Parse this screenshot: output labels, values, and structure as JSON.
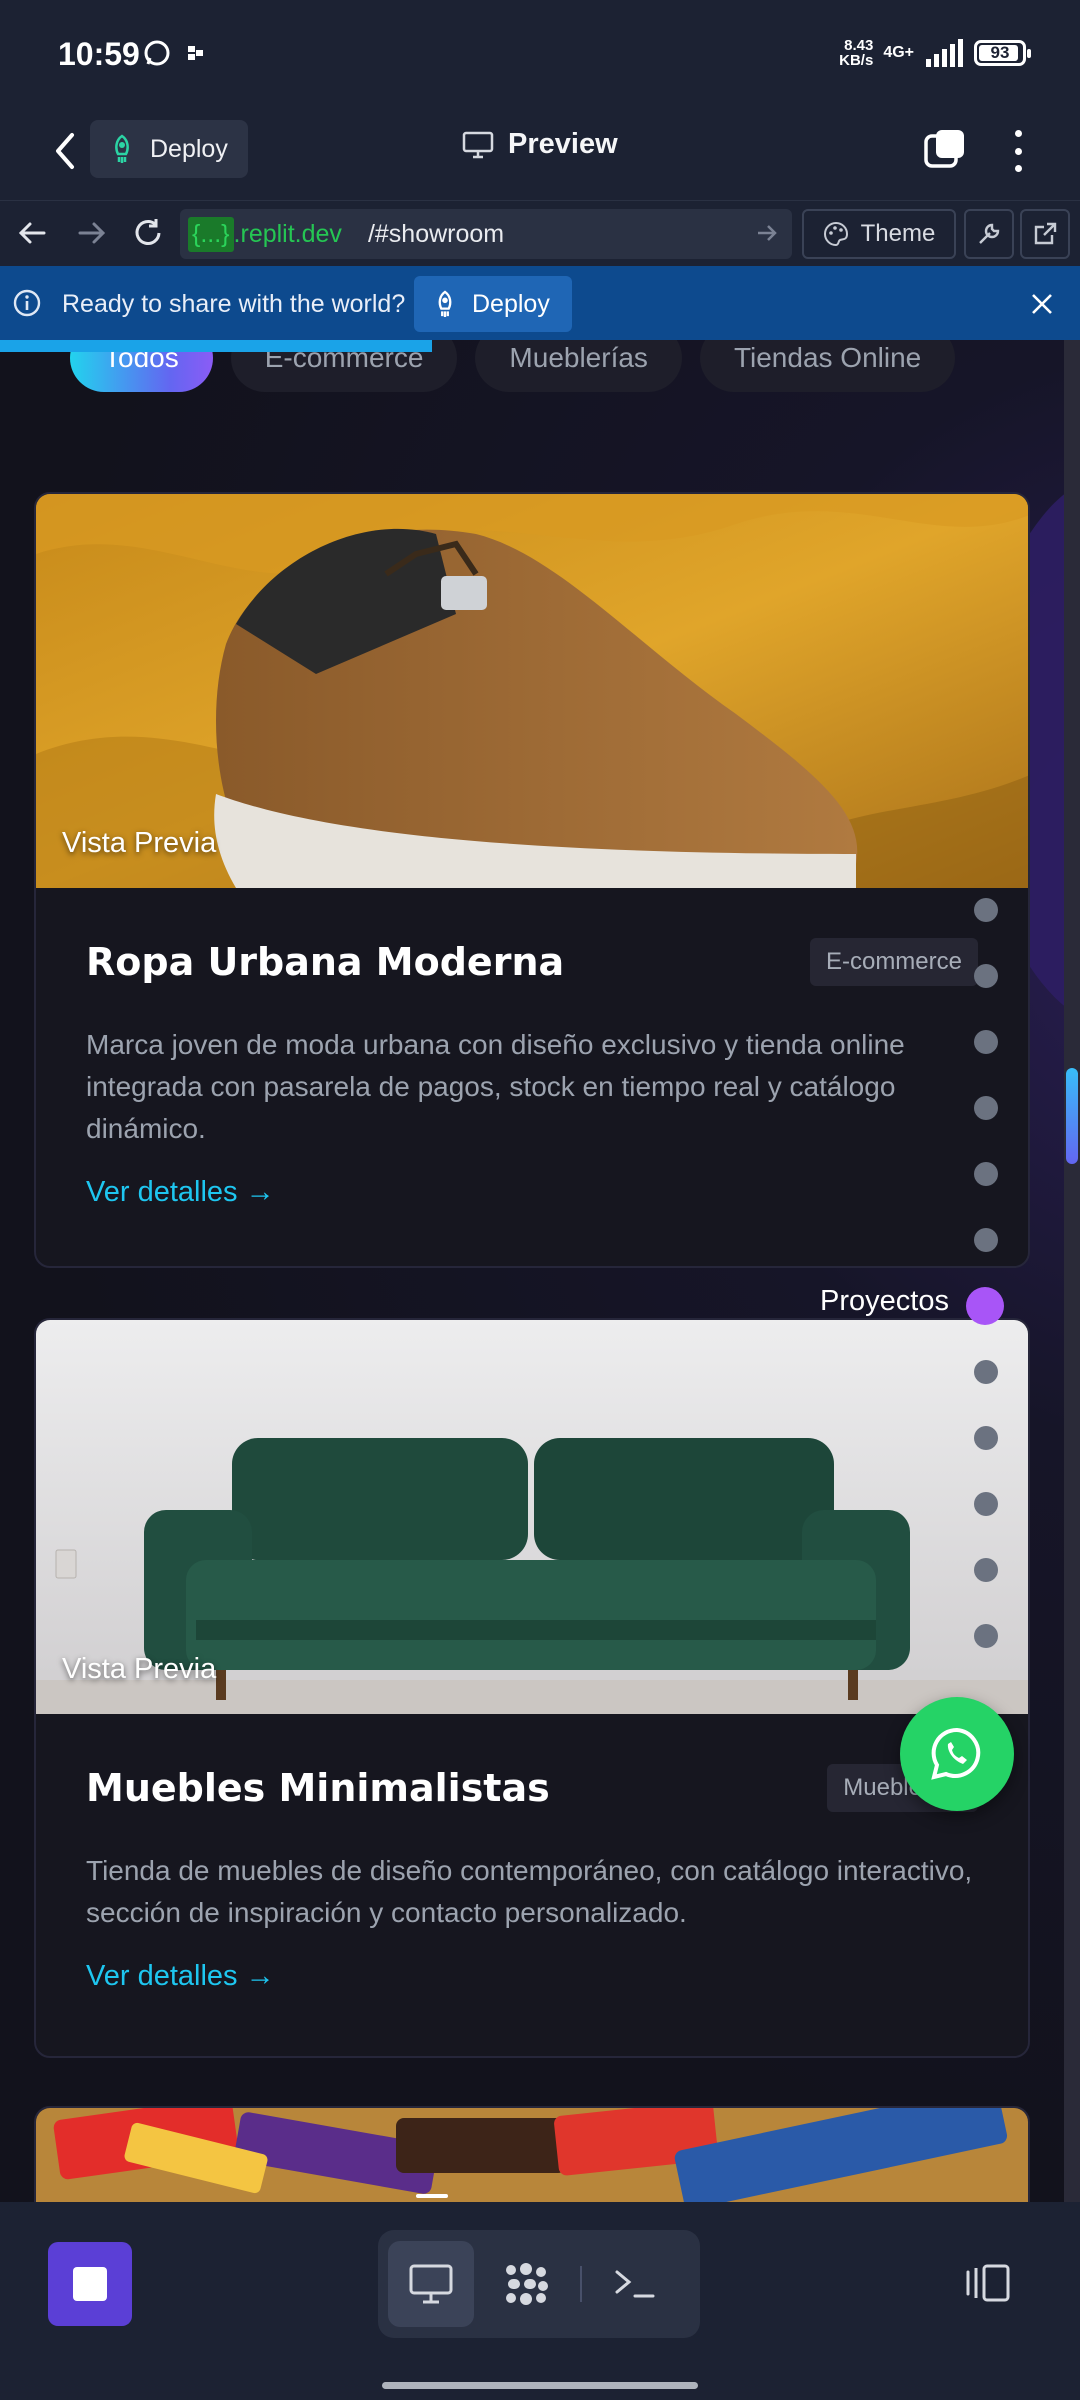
{
  "status_bar": {
    "time": "10:59",
    "net_speed_value": "8.43",
    "net_speed_unit": "KB/s",
    "network": "4G+",
    "battery": "93"
  },
  "app_bar": {
    "deploy_label": "Deploy",
    "title": "Preview"
  },
  "url_bar": {
    "host_highlight": "{...}",
    "host": ".replit.dev",
    "path": "/#showroom",
    "theme_label": "Theme"
  },
  "banner": {
    "text": "Ready to share with the world?",
    "deploy_label": "Deploy",
    "load_progress": 0.4
  },
  "filters": [
    {
      "label": "Todos",
      "active": true
    },
    {
      "label": "E-commerce",
      "active": false
    },
    {
      "label": "Mueblerías",
      "active": false
    },
    {
      "label": "Tiendas Online",
      "active": false
    }
  ],
  "cards": [
    {
      "preview_label": "Vista Previa",
      "title": "Ropa Urbana Moderna",
      "tag": "E-commerce",
      "description": "Marca joven de moda urbana con diseño exclusivo y tienda online integrada con pasarela de pagos, stock en tiempo real y catálogo dinámico.",
      "link": "Ver detalles →"
    },
    {
      "preview_label": "Vista Previa",
      "title": "Muebles Minimalistas",
      "tag": "Mueblerías",
      "description": "Tienda de muebles de diseño contemporáneo, con catálogo interactivo, sección de inspiración y contacto personalizado.",
      "link": "Ver detalles →"
    }
  ],
  "section_nav": {
    "active_label": "Proyectos",
    "dot_count": 12,
    "active_index": 6
  },
  "colors": {
    "accent_cyan": "#22d3ee",
    "accent_purple": "#a855f7",
    "link": "#1ec6f0",
    "whatsapp": "#25d366",
    "banner": "#0d4a8e"
  }
}
